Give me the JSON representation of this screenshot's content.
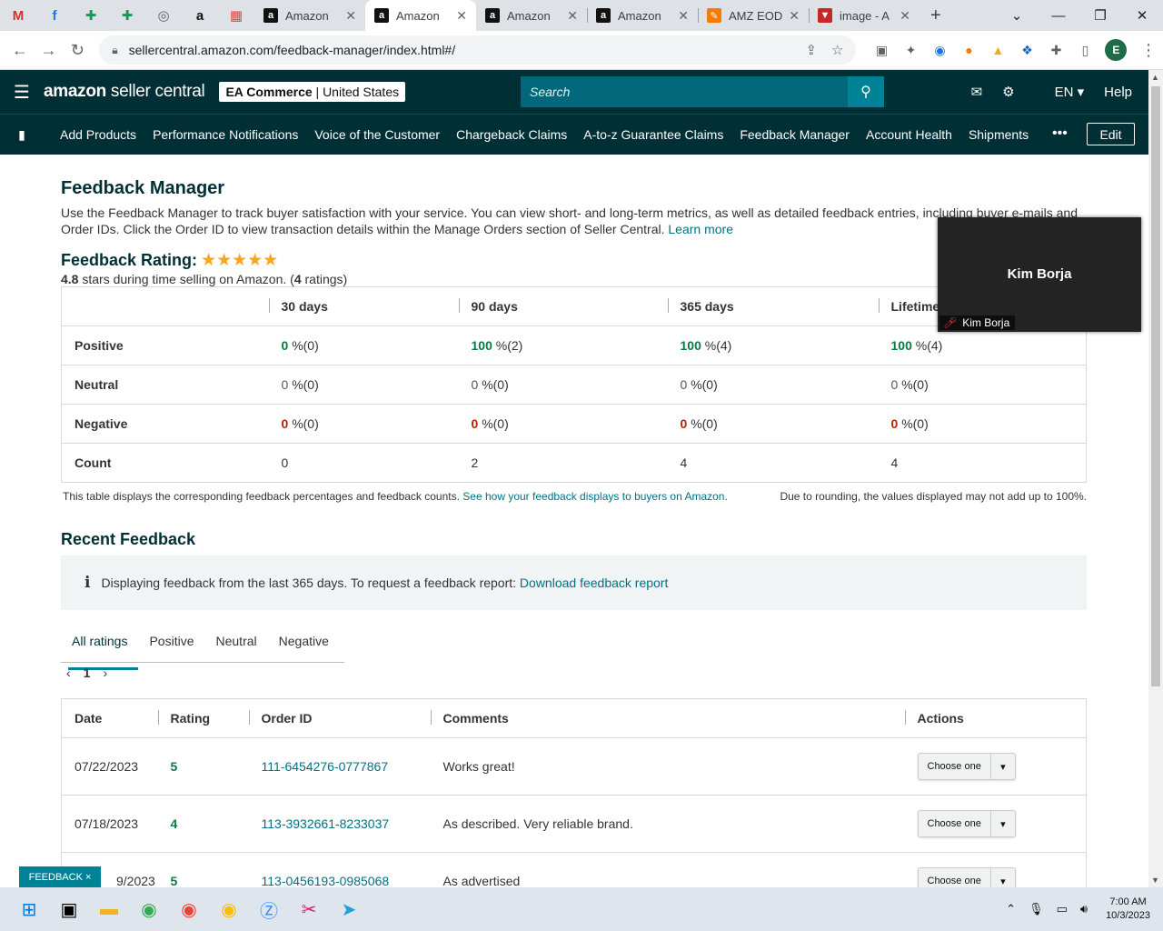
{
  "browser": {
    "tabs": [
      {
        "label": "Amazon",
        "active": false
      },
      {
        "label": "Amazon",
        "active": true
      },
      {
        "label": "Amazon",
        "active": false
      },
      {
        "label": "Amazon",
        "active": false
      },
      {
        "label": "AMZ EOD",
        "active": false
      },
      {
        "label": "image - A",
        "active": false
      }
    ],
    "url": "sellercentral.amazon.com/feedback-manager/index.html#/",
    "profile_initial": "E"
  },
  "header": {
    "logo_bold": "amazon",
    "logo_light": " seller central",
    "account_name": "EA Commerce",
    "account_region": "United States",
    "search_placeholder": "Search",
    "language": "EN",
    "help": "Help"
  },
  "nav": {
    "links": [
      "Add Products",
      "Performance Notifications",
      "Voice of the Customer",
      "Chargeback Claims",
      "A-to-z Guarantee Claims",
      "Feedback Manager",
      "Account Health",
      "Shipments"
    ],
    "more": "•••",
    "edit": "Edit"
  },
  "page": {
    "title": "Feedback Manager",
    "intro": "Use the Feedback Manager to track buyer satisfaction with your service. You can view short- and long-term metrics, as well as detailed feedback entries, including buyer e-mails and Order IDs. Click the Order ID to view transaction details within the Manage Orders section of Seller Central.",
    "learn_more": "Learn more",
    "rating_heading": "Feedback Rating:",
    "stars": "★★★★★",
    "rating_value": "4.8",
    "rating_text": "stars during time selling on Amazon. (",
    "rating_count": "4",
    "rating_suffix": "ratings)",
    "metrics": {
      "columns": [
        "30 days",
        "90 days",
        "365 days",
        "Lifetime"
      ],
      "rows": [
        {
          "label": "Positive",
          "values": [
            "0",
            "100",
            "100",
            "100"
          ],
          "details": [
            "%(0)",
            "%(2)",
            "%(4)",
            "%(4)"
          ]
        },
        {
          "label": "Neutral",
          "values": [
            "0",
            "0",
            "0",
            "0"
          ],
          "details": [
            "%(0)",
            "%(0)",
            "%(0)",
            "%(0)"
          ]
        },
        {
          "label": "Negative",
          "values": [
            "0",
            "0",
            "0",
            "0"
          ],
          "details": [
            "%(0)",
            "%(0)",
            "%(0)",
            "%(0)"
          ]
        },
        {
          "label": "Count",
          "values": [
            "0",
            "2",
            "4",
            "4"
          ]
        }
      ]
    },
    "note_left": "This table displays the corresponding feedback percentages and feedback counts.",
    "note_link": "See how your feedback displays to buyers on Amazon.",
    "note_right": "Due to rounding, the values displayed may not add up to 100%.",
    "recent_title": "Recent Feedback",
    "info_text": "Displaying feedback from the last 365 days. To request a feedback report:",
    "info_link": "Download feedback report",
    "filter_tabs": [
      "All ratings",
      "Positive",
      "Neutral",
      "Negative"
    ],
    "page_number": "1",
    "feedback_columns": [
      "Date",
      "Rating",
      "Order ID",
      "Comments",
      "Actions"
    ],
    "feedback_rows": [
      {
        "date": "07/22/2023",
        "rating": "5",
        "order": "111-6454276-0777867",
        "comment": "Works great!",
        "action": "Choose one"
      },
      {
        "date": "07/18/2023",
        "rating": "4",
        "order": "113-3932661-8233037",
        "comment": "As described. Very reliable brand.",
        "action": "Choose one"
      },
      {
        "date": "9/2023",
        "rating": "5",
        "order": "113-0456193-0985068",
        "comment": "As advertised",
        "action": "Choose one"
      }
    ]
  },
  "overlay": {
    "participant_name": "Kim Borja",
    "participant_tag": "Kim Borja"
  },
  "feedback_button": "FEEDBACK ×",
  "taskbar": {
    "time": "7:00 AM",
    "date": "10/3/2023"
  }
}
